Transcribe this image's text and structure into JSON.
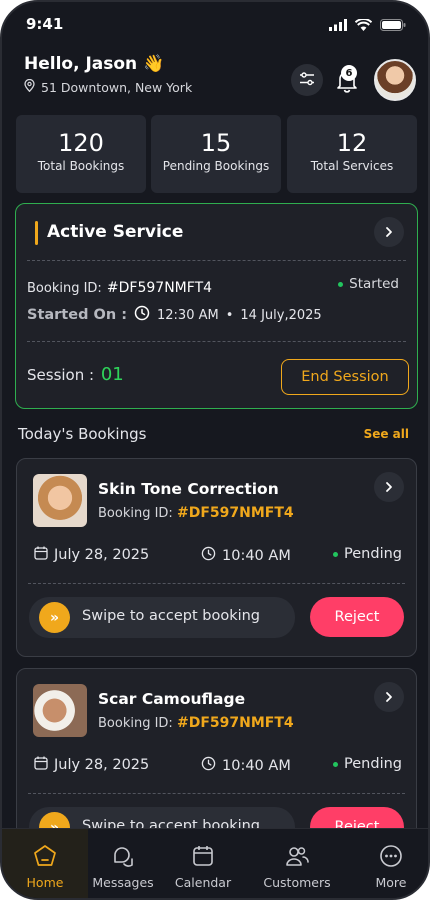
{
  "status_bar": {
    "time": "9:41"
  },
  "header": {
    "greeting": "Hello, Jason 👋",
    "location": "51 Downtown, New York",
    "notification_count": "6"
  },
  "stats": [
    {
      "value": "120",
      "label": "Total Bookings"
    },
    {
      "value": "15",
      "label": "Pending Bookings"
    },
    {
      "value": "12",
      "label": "Total Services"
    }
  ],
  "active_service": {
    "title": "Active Service",
    "booking_id_label": "Booking ID:",
    "booking_id": "#DF597NMFT4",
    "status": "Started",
    "started_on_label": "Started On :",
    "started_time": "12:30 AM",
    "started_date": "14 July,2025",
    "session_label": "Session :",
    "session_number": "01",
    "end_button": "End Session"
  },
  "bookings_section": {
    "title": "Today's Bookings",
    "see_all": "See all"
  },
  "bookings": [
    {
      "name": "Skin Tone Correction",
      "booking_id_label": "Booking ID:",
      "booking_id": "#DF597NMFT4",
      "date": "July 28, 2025",
      "time": "10:40 AM",
      "status": "Pending",
      "swipe_text": "Swipe to accept booking",
      "reject": "Reject"
    },
    {
      "name": "Scar Camouflage",
      "booking_id_label": "Booking ID:",
      "booking_id": "#DF597NMFT4",
      "date": "July 28, 2025",
      "time": "10:40 AM",
      "status": "Pending",
      "swipe_text": "Swipe to accept booking",
      "reject": "Reject"
    }
  ],
  "tabbar": [
    {
      "label": "Home",
      "icon": "home-pentagon-icon",
      "active": true
    },
    {
      "label": "Messages",
      "icon": "messages-icon",
      "active": false
    },
    {
      "label": "Calendar",
      "icon": "calendar-icon",
      "active": false
    },
    {
      "label": "Customers",
      "icon": "customers-icon",
      "active": false
    },
    {
      "label": "More",
      "icon": "more-icon",
      "active": false
    }
  ],
  "colors": {
    "background": "#16181f",
    "card": "#1f2128",
    "accent": "#f0a81c",
    "success": "#22c55e",
    "danger": "#ff3e67"
  }
}
